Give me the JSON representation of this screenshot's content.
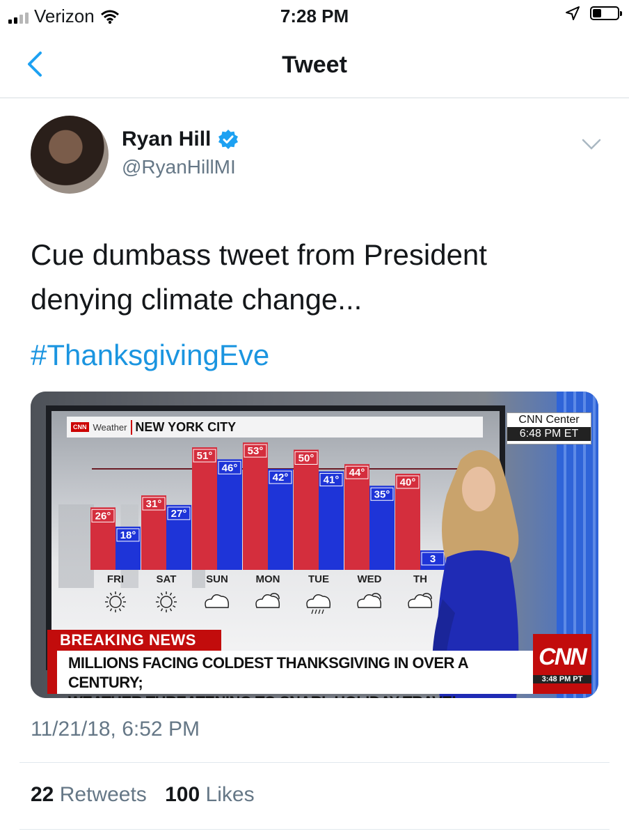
{
  "status_bar": {
    "carrier": "Verizon",
    "time": "7:28 PM",
    "signal_bars": 2,
    "battery_level": 0.35
  },
  "nav": {
    "title": "Tweet",
    "back_icon": "chevron-left-icon",
    "accent": "#1da1f2"
  },
  "author": {
    "name": "Ryan Hill",
    "handle": "@RyanHillMI",
    "verified": true
  },
  "tweet": {
    "text_line1": "Cue dumbass tweet from President",
    "text_line2": "denying climate change...",
    "hashtag": "#ThanksgivingEve"
  },
  "media": {
    "cnn_label": "CNN",
    "weather_label": "Weather",
    "city": "NEW YORK CITY",
    "cnn_center_title": "CNN Center",
    "cnn_center_time": "6:48 PM ET",
    "breaking_label": "BREAKING NEWS",
    "headline_line1": "MILLIONS FACING COLDEST THANKSGIVING IN OVER A CENTURY;",
    "headline_line2": "WEATHER THREATENING TO SNARL HOLIDAY TRAVEL",
    "logo_word": "CNN",
    "logo_time": "3:48 PM PT",
    "high_color": "#d42e3d",
    "low_color": "#1e34d8"
  },
  "chart_data": {
    "type": "bar",
    "categories": [
      "FRI",
      "SAT",
      "SUN",
      "MON",
      "TUE",
      "WED",
      "TH"
    ],
    "series": [
      {
        "values": [
          26,
          31,
          51,
          53,
          50,
          44,
          40
        ]
      },
      {
        "values": [
          18,
          27,
          46,
          42,
          41,
          35,
          3
        ]
      }
    ],
    "value_labels": {
      "high": [
        "26°",
        "31°",
        "51°",
        "53°",
        "50°",
        "44°",
        "40°"
      ],
      "low": [
        "18°",
        "27°",
        "46°",
        "42°",
        "41°",
        "35°",
        "3"
      ]
    },
    "icons": [
      "sun-icon",
      "sun-icon",
      "cloud-icon",
      "partly-cloudy-icon",
      "rain-cloud-icon",
      "partly-cloudy-icon",
      "partly-cloudy-icon"
    ]
  },
  "footer": {
    "timestamp": "11/21/18, 6:52 PM",
    "retweets_count": "22",
    "retweets_label": "Retweets",
    "likes_count": "100",
    "likes_label": "Likes"
  }
}
